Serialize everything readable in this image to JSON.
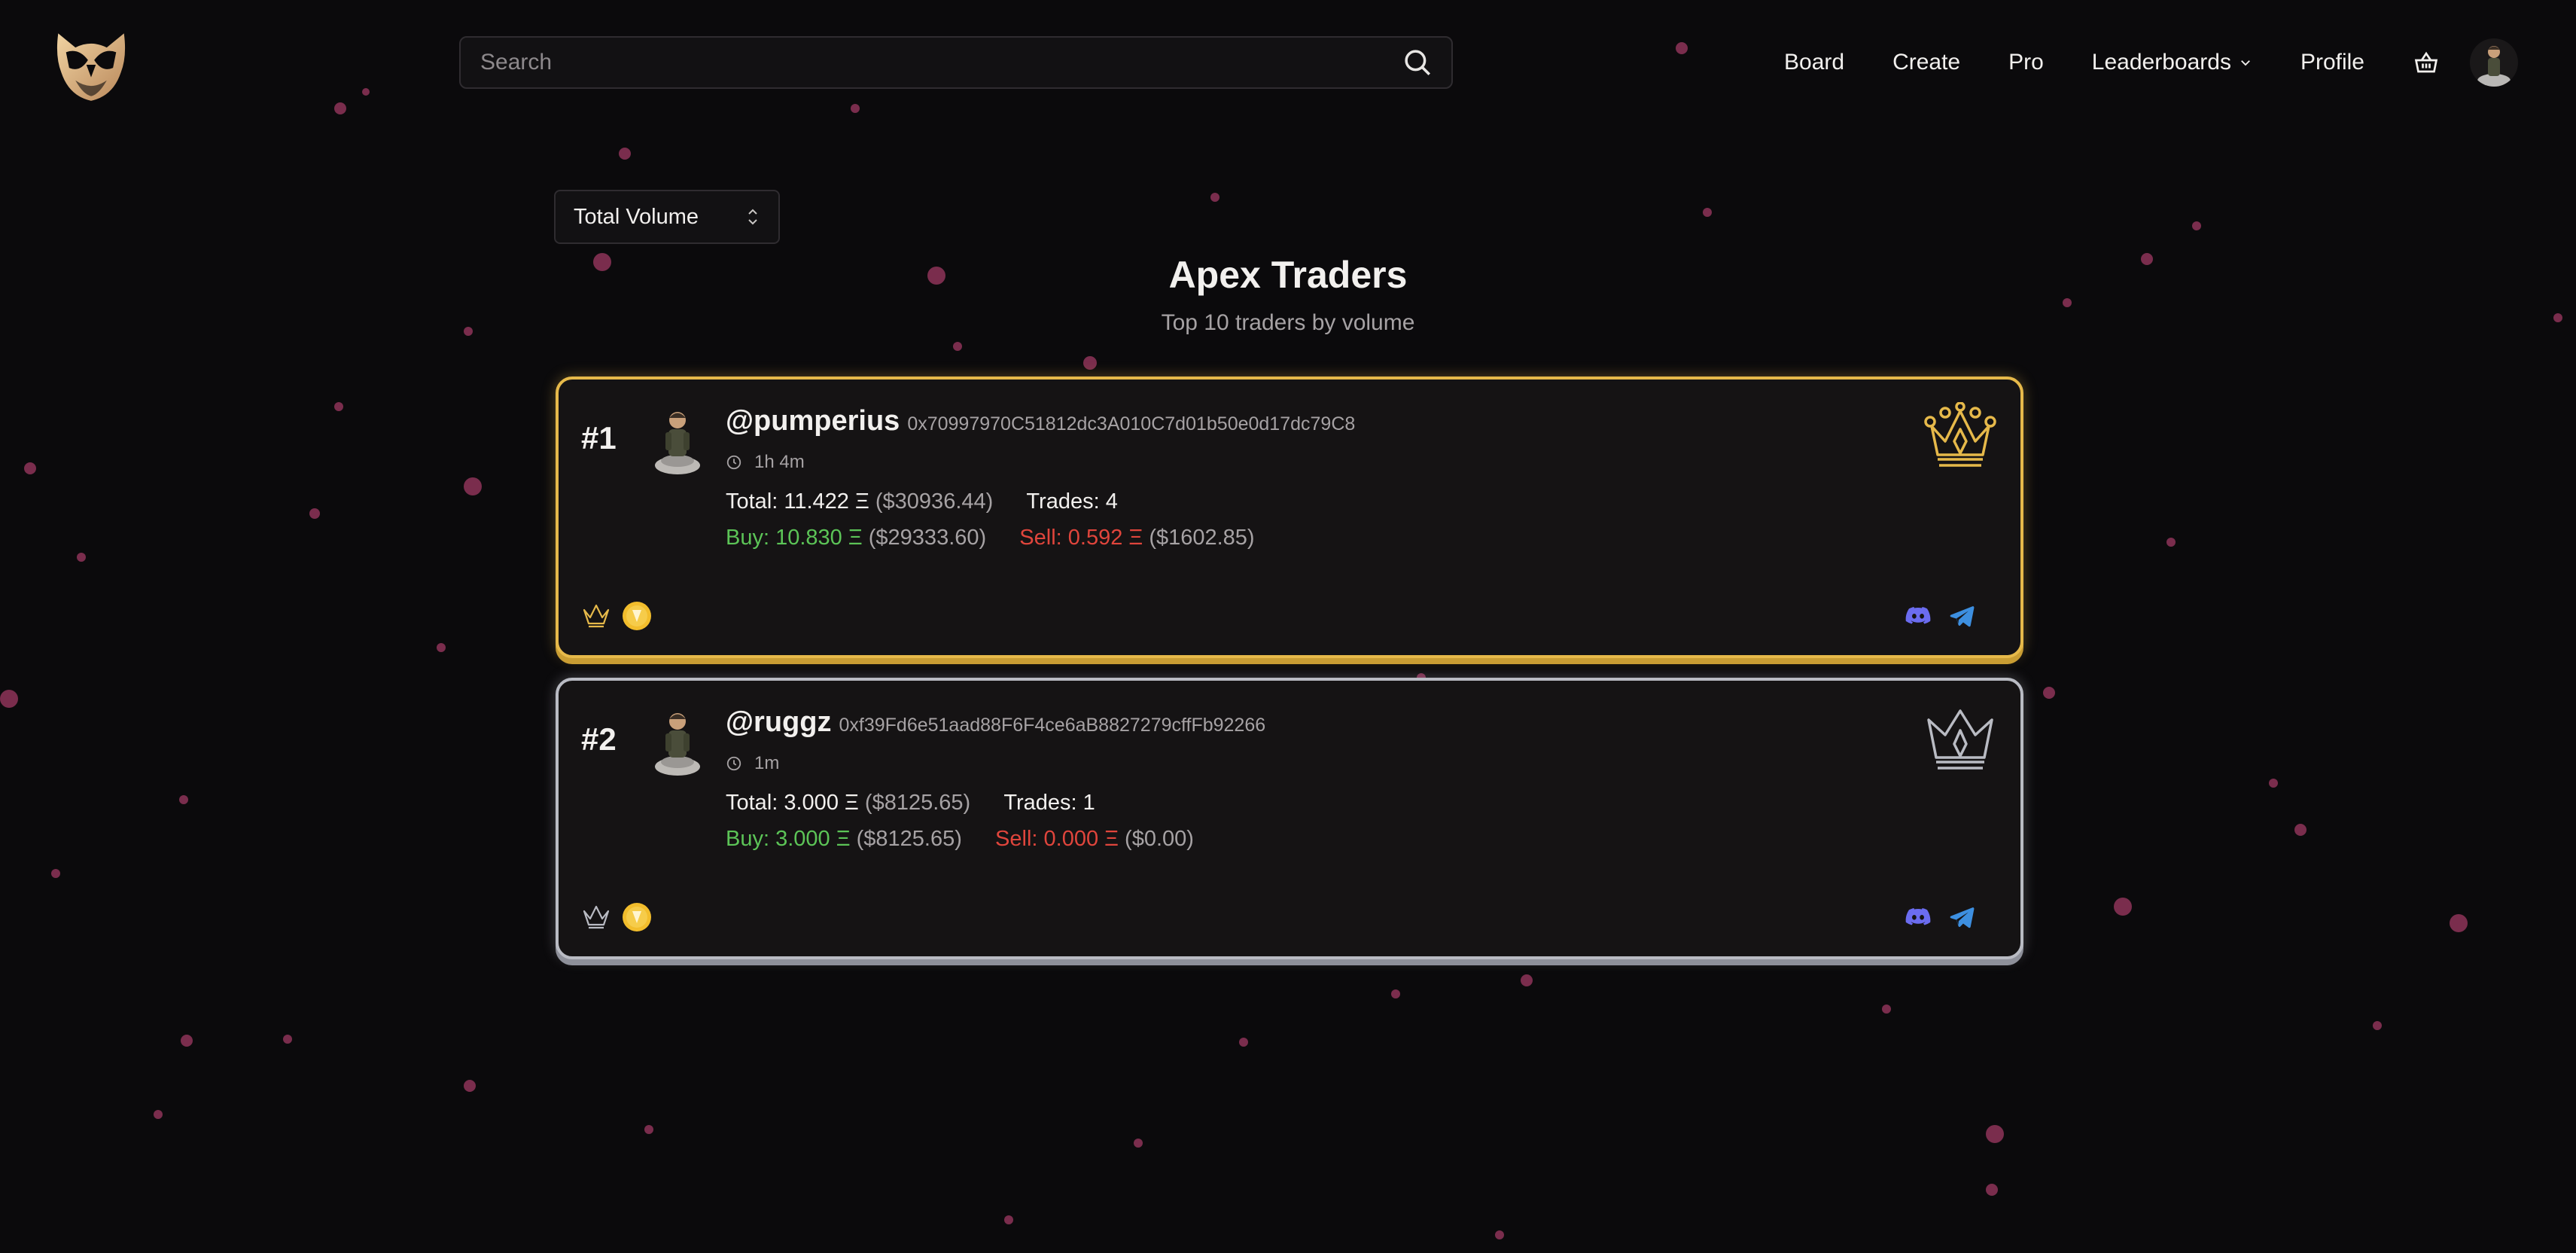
{
  "colors": {
    "background": "#0b0a0c",
    "gold": "#e6b94a",
    "silver": "#b9bbc3",
    "buy": "#5cc457",
    "sell": "#e0453c",
    "discord": "#6b6cf0",
    "telegram": "#3d8fe0",
    "dots": "#7a2d4d"
  },
  "header": {
    "logo_icon": "owl-logo-icon",
    "search": {
      "placeholder": "Search",
      "value": "",
      "icon": "search-icon"
    },
    "nav": [
      {
        "label": "Board"
      },
      {
        "label": "Create"
      },
      {
        "label": "Pro"
      },
      {
        "label": "Leaderboards",
        "icon": "chevron-down-icon"
      },
      {
        "label": "Profile"
      }
    ],
    "cart_icon": "basket-icon",
    "avatar_icon": "user-avatar"
  },
  "sort_select": {
    "selected": "Total Volume",
    "icon": "up-down-chevron-icon"
  },
  "page": {
    "title": "Apex Traders",
    "subtitle": "Top 10 traders by volume"
  },
  "traders": [
    {
      "rank": "#1",
      "username": "@pumperius",
      "address": "0x70997970C51812dc3A010C7d01b50e0d17dc79C8",
      "time": "1h 4m",
      "total": "Total: 11.422 Ξ",
      "total_usd": "($30936.44)",
      "trades": "Trades: 4",
      "buy": "Buy: 10.830 Ξ",
      "buy_usd": "($29333.60)",
      "sell": "Sell: 0.592 Ξ",
      "sell_usd": "($1602.85)",
      "tier": "gold",
      "badge_icons": [
        "small-crown-icon",
        "coin-badge-icon"
      ],
      "social_icons": [
        "discord-icon",
        "telegram-icon"
      ]
    },
    {
      "rank": "#2",
      "username": "@ruggz",
      "address": "0xf39Fd6e51aad88F6F4ce6aB8827279cffFb92266",
      "time": "1m",
      "total": "Total: 3.000 Ξ",
      "total_usd": "($8125.65)",
      "trades": "Trades: 1",
      "buy": "Buy: 3.000 Ξ",
      "buy_usd": "($8125.65)",
      "sell": "Sell: 0.000 Ξ",
      "sell_usd": "($0.00)",
      "tier": "silver",
      "badge_icons": [
        "small-crown-icon",
        "coin-badge-icon"
      ],
      "social_icons": [
        "discord-icon",
        "telegram-icon"
      ]
    }
  ]
}
